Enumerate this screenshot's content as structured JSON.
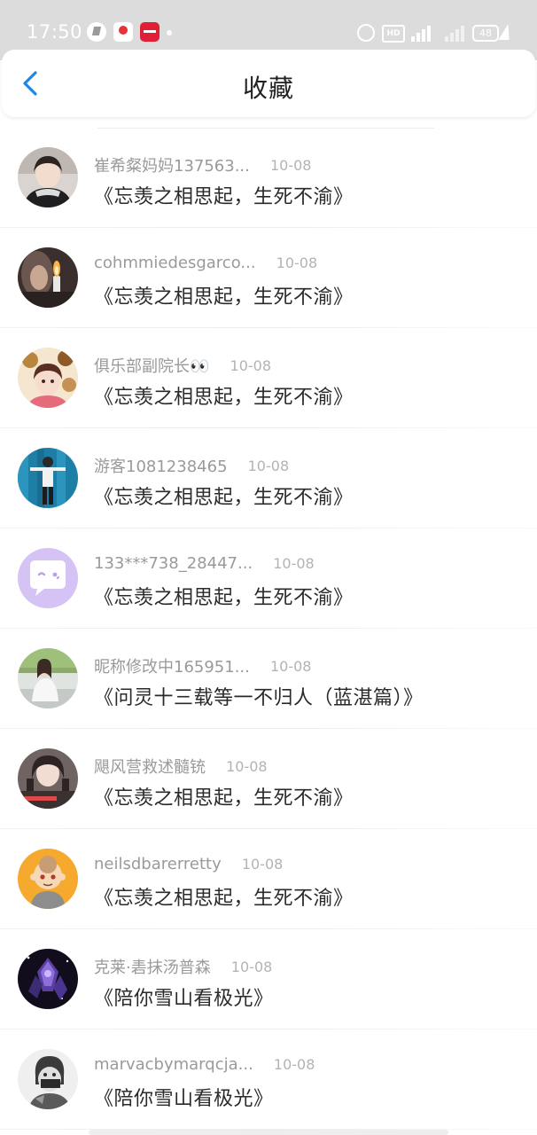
{
  "status_bar": {
    "time": "17:50",
    "hd_label": "HD",
    "battery_level": "48",
    "app_icons": [
      "navigation-app-icon",
      "news-app-icon",
      "shopping-app-icon"
    ]
  },
  "header": {
    "back_icon": "chevron-left-icon",
    "title": "收藏"
  },
  "colors": {
    "accent": "#1e88e5",
    "status_bar_bg": "#dcdcdc",
    "username_gray": "#9a9a9a",
    "title_text": "#2a2a2a"
  },
  "items": [
    {
      "username": "崔希粲妈妈137563...",
      "date": "10-08",
      "title": "《忘羡之相思起，生死不渝》",
      "avatar": "portrait-woman-dark-jacket"
    },
    {
      "username": "cohmmiedesgarco...",
      "date": "10-08",
      "title": "《忘羡之相思起，生死不渝》",
      "avatar": "lighter-flame-photo"
    },
    {
      "username": "俱乐部副院长👀",
      "date": "10-08",
      "title": "《忘羡之相思起，生死不渝》",
      "avatar": "anime-girl-with-cats"
    },
    {
      "username": "游客1081238465",
      "date": "10-08",
      "title": "《忘羡之相思起，生死不渝》",
      "avatar": "dancer-blue-curtain"
    },
    {
      "username": "133***738_28447...",
      "date": "10-08",
      "title": "《忘羡之相思起，生死不渝》",
      "avatar": "default-chat-bubble-avatar"
    },
    {
      "username": "昵称修改中165951...",
      "date": "10-08",
      "title": "《问灵十三载等一不归人（蓝湛篇）》",
      "avatar": "girl-outdoor-photo"
    },
    {
      "username": "飓风营救述髓铳",
      "date": "10-08",
      "title": "《忘羡之相思起，生死不渝》",
      "avatar": "girl-portrait-red-text"
    },
    {
      "username": "neilsdbarerretty",
      "date": "10-08",
      "title": "《忘羡之相思起，生死不渝》",
      "avatar": "cartoon-bald-monk"
    },
    {
      "username": "克莱·砉抹汤普森",
      "date": "10-08",
      "title": "《陪你雪山看极光》",
      "avatar": "purple-crystal-art"
    },
    {
      "username": "marvacbymarqcja...",
      "date": "10-08",
      "title": "《陪你雪山看极光》",
      "avatar": "sketch-masked-figure"
    }
  ]
}
